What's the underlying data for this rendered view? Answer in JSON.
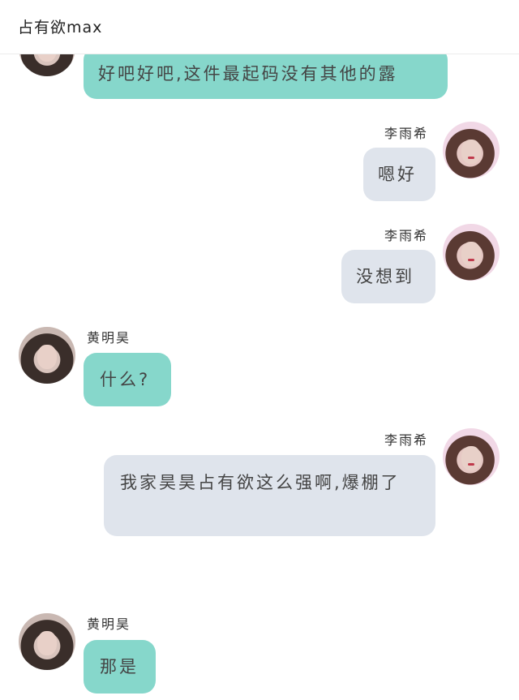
{
  "header": {
    "title": "占有欲max"
  },
  "messages": [
    {
      "sender": "",
      "side": "left",
      "text": "好吧好吧,这件最起码没有其他的露"
    },
    {
      "sender": "李雨希",
      "side": "right",
      "text": "嗯好"
    },
    {
      "sender": "李雨希",
      "side": "right",
      "text": "没想到"
    },
    {
      "sender": "黄明昊",
      "side": "left",
      "text": "什么?"
    },
    {
      "sender": "李雨希",
      "side": "right",
      "text": "我家昊昊占有欲这么强啊,爆棚了"
    },
    {
      "sender": "黄明昊",
      "side": "left",
      "text": "那是"
    }
  ],
  "colors": {
    "left_bubble": "#86d7cb",
    "right_bubble": "#dfe4ec",
    "header_bg": "#ffffff"
  }
}
